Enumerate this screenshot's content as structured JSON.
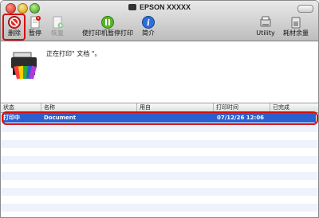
{
  "window": {
    "title": "EPSON XXXXX"
  },
  "toolbar": {
    "delete": "删除",
    "hold": "暂停",
    "resume": "恢复",
    "pause_printer": "使打印机暂停打印",
    "info": "简介",
    "utility": "Utility",
    "supplies": "耗材余量"
  },
  "status": {
    "message": "正在打印\" 文档 \"。"
  },
  "table": {
    "columns": [
      "状态",
      "名称",
      "用自",
      "打印时间",
      "已完成"
    ],
    "rows": [
      {
        "status": "打印中",
        "name": "Document",
        "from": "",
        "time": "07/12/26 12:06",
        "completed": ""
      }
    ]
  },
  "colors": {
    "selection": "#2a5fd0",
    "highlight_frame": "#d41010"
  },
  "icons": [
    "delete-icon",
    "hold-icon",
    "resume-icon",
    "pause-printer-icon",
    "info-icon",
    "utility-icon",
    "supplies-icon",
    "printer-icon"
  ]
}
